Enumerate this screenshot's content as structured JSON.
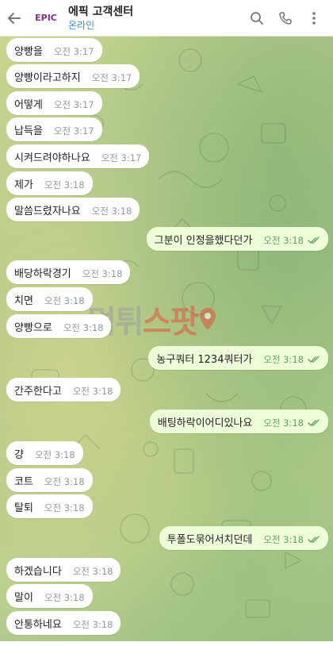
{
  "header": {
    "avatar_text": "EPIC",
    "title": "에픽 고객센터",
    "status": "온라인",
    "icons": [
      "back-arrow-icon",
      "search-icon",
      "phone-icon",
      "more-vert-icon"
    ]
  },
  "messages": [
    {
      "dir": "in",
      "text": "양빵을",
      "time": "오전 3:17"
    },
    {
      "dir": "in",
      "text": "양빵이라고하지",
      "time": "오전 3:17"
    },
    {
      "dir": "in",
      "text": "어떻게",
      "time": "오전 3:17"
    },
    {
      "dir": "in",
      "text": "납득을",
      "time": "오전 3:17"
    },
    {
      "dir": "in",
      "text": "시켜드려야하나요",
      "time": "오전 3:17"
    },
    {
      "dir": "in",
      "text": "제가",
      "time": "오전 3:18"
    },
    {
      "dir": "in",
      "text": "말씀드렸자나요",
      "time": "오전 3:18"
    },
    {
      "dir": "out",
      "text": "그분이 인정을했다던가",
      "time": "오전 3:18"
    },
    {
      "dir": "in",
      "text": "배당하락경기",
      "time": "오전 3:18"
    },
    {
      "dir": "in",
      "text": "치면",
      "time": "오전 3:18"
    },
    {
      "dir": "in",
      "text": "양빵으로",
      "time": "오전 3:18"
    },
    {
      "dir": "out",
      "text": "농구쿼터 1234쿼터가",
      "time": "오전 3:18"
    },
    {
      "dir": "in",
      "text": "간주한다고",
      "time": "오전 3:18"
    },
    {
      "dir": "out",
      "text": "배팅하락이어디있나요",
      "time": "오전 3:18"
    },
    {
      "dir": "in",
      "text": "걍",
      "time": "오전 3:18"
    },
    {
      "dir": "in",
      "text": "코트",
      "time": "오전 3:18"
    },
    {
      "dir": "in",
      "text": "탈퇴",
      "time": "오전 3:18"
    },
    {
      "dir": "out",
      "text": "투폴도묶어서치던데",
      "time": "오전 3:18"
    },
    {
      "dir": "in",
      "text": "하겠습니다",
      "time": "오전 3:18"
    },
    {
      "dir": "in",
      "text": "말이",
      "time": "오전 3:18"
    },
    {
      "dir": "in",
      "text": "안통하네요",
      "time": "오전 3:18"
    }
  ],
  "watermark": {
    "part1": "먹튀",
    "part2": "스팟"
  },
  "colors": {
    "incoming_bubble": "#ffffff",
    "outgoing_bubble": "#eefed9",
    "outgoing_time": "#5fa462",
    "status_blue": "#3f8fd4",
    "avatar_text": "#8a2b86"
  }
}
